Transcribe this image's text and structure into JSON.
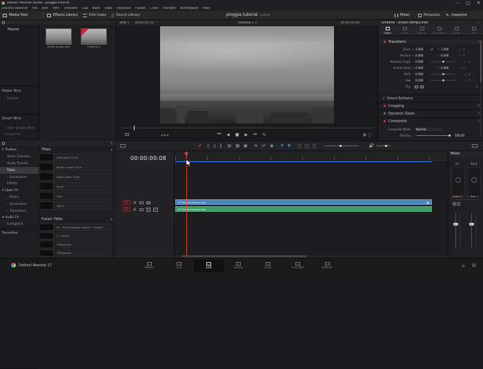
{
  "titlebar": {
    "app_title": "DaVinci Resolve Studio - pioggia tutorial"
  },
  "menubar": {
    "items": [
      "DaVinci Resolve",
      "File",
      "Edit",
      "Trim",
      "Timeline",
      "Clip",
      "Mark",
      "View",
      "Playback",
      "Fusion",
      "Color",
      "Fairlight",
      "Workspace",
      "Help"
    ]
  },
  "toolbar": {
    "media_pool": "Media Pool",
    "effects_library": "Effects Library",
    "edit_index": "Edit Index",
    "sound_library": "Sound Library",
    "project_name": "pioggia tutorial",
    "project_status": "Edited",
    "mixer": "Mixer",
    "metadata": "Metadata",
    "inspector": "Inspector"
  },
  "media_pool": {
    "master_label": "Master",
    "power_bins": "Power Bins",
    "power_bins_item": "Master",
    "smart_bins": "Smart Bins",
    "smart_bins_items": [
      "User Smart Bins",
      "Keywords"
    ],
    "clips": [
      {
        "label": "brutto tempo.mov"
      },
      {
        "label": "Timeline 1"
      }
    ]
  },
  "viewer": {
    "zoom": "30%",
    "source_timecode": "00:00:05:10",
    "timeline_name": "Timeline 1",
    "record_timecode": "00:00:00:08",
    "transport_controls": [
      "jump-start",
      "step-back",
      "stop",
      "play",
      "step-forward",
      "loop"
    ]
  },
  "inspector": {
    "title": "Timeline - brutto tempo.mov",
    "tabs": [
      "Video",
      "Audio",
      "Effects",
      "Transition",
      "Image",
      "File"
    ],
    "transform_section": "Transform",
    "zoom": {
      "label": "Zoom",
      "x": "1.000",
      "y": "1.000"
    },
    "position": {
      "label": "Position",
      "x": "0.000",
      "y": "0.000"
    },
    "rotation": {
      "label": "Rotation Angle",
      "value": "0.000"
    },
    "anchor": {
      "label": "Anchor Point",
      "x": "0.000",
      "y": "0.000"
    },
    "pitch": {
      "label": "Pitch",
      "value": "0.000"
    },
    "yaw": {
      "label": "Yaw",
      "value": "0.000"
    },
    "flip": {
      "label": "Flip"
    },
    "smart_reframe": "Smart Reframe",
    "cropping": "Cropping",
    "dynamic_zoom": "Dynamic Zoom",
    "composite": "Composite",
    "composite_mode": {
      "label": "Composite Mode",
      "value": "Normal"
    },
    "opacity": {
      "label": "Opacity",
      "value": "100.00"
    }
  },
  "effects_panel": {
    "tree": [
      {
        "label": "Toolbox",
        "level": 0
      },
      {
        "label": "Video Transitio...",
        "level": 1
      },
      {
        "label": "Audio Transiti...",
        "level": 1
      },
      {
        "label": "Titles",
        "level": 1,
        "selected": true
      },
      {
        "label": "Generators",
        "level": 1
      },
      {
        "label": "Effects",
        "level": 1
      },
      {
        "label": "Open FX",
        "level": 0
      },
      {
        "label": "Filters",
        "level": 1
      },
      {
        "label": "Generators",
        "level": 1
      },
      {
        "label": "Transitions",
        "level": 1
      },
      {
        "label": "Audio FX",
        "level": 0
      },
      {
        "label": "FairlightFX",
        "level": 1
      }
    ],
    "favorites": "Favorites",
    "titles_header": "Titles",
    "titles": [
      "Left Lower Third",
      "Middle Lower Third",
      "Right Lower Third",
      "Scroll",
      "Text",
      "Text+"
    ],
    "fusion_titles_header": "Fusion Titles",
    "fusion_titles": [
      "01 - Prova pioggia caduta - Vulsesh",
      "1 - Varios",
      "7Rilligroom",
      "7Rilligroom"
    ]
  },
  "timeline": {
    "timecode": "00:00:00:08",
    "tracks": [
      {
        "id": "V1",
        "clip_label": "brutto tempo.mov",
        "color": "#4f86b6"
      },
      {
        "id": "A1",
        "clip_label": "brutto tempo.mov",
        "color": "#3f9a68"
      }
    ]
  },
  "mixer": {
    "title": "Mixer",
    "channels": [
      {
        "label": "A1"
      },
      {
        "label": "Bus1"
      }
    ],
    "channel_bottom_labels": [
      "Audio 1",
      "Bus 1"
    ]
  },
  "pagebar": {
    "app_name": "DaVinci Resolve 17",
    "pages": [
      "Media",
      "Cut",
      "Edit",
      "Fusion",
      "Color",
      "Fairlight",
      "Deliver"
    ],
    "active_page": "Edit"
  }
}
